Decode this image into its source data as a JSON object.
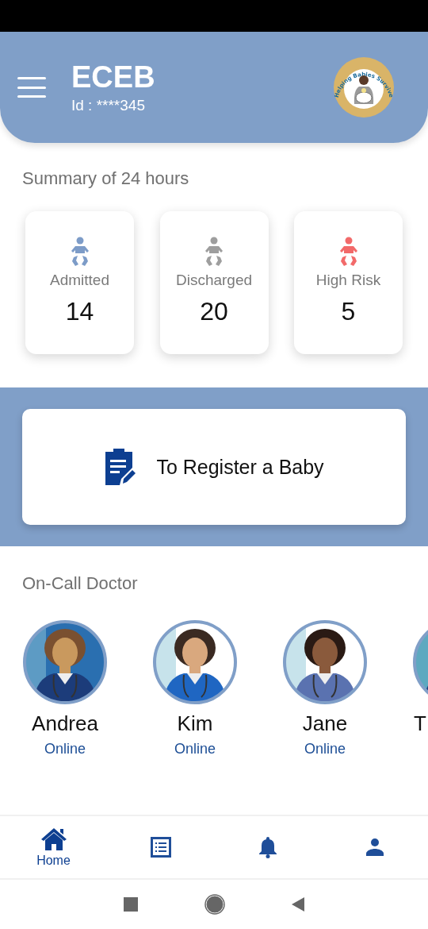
{
  "header": {
    "title": "ECEB",
    "id_text": "Id : ****345",
    "logo_text": "Helping Babies Survive"
  },
  "summary": {
    "title": "Summary of 24 hours",
    "stats": [
      {
        "label": "Admitted",
        "value": "14",
        "color": "#7d9cc8"
      },
      {
        "label": "Discharged",
        "value": "20",
        "color": "#9e9e9e"
      },
      {
        "label": "High Risk",
        "value": "5",
        "color": "#f26a6a"
      }
    ]
  },
  "register": {
    "label": "To Register a Baby"
  },
  "doctors": {
    "title": "On-Call Doctor",
    "items": [
      {
        "name": "Andrea",
        "status": "Online",
        "kind": "picture"
      },
      {
        "name": "Kim",
        "status": "Online",
        "kind": "picture"
      },
      {
        "name": "Jane",
        "status": "Online",
        "kind": "picture"
      },
      {
        "name": "T",
        "kind": "picture"
      }
    ]
  },
  "nav": [
    {
      "kind": "home",
      "label": "Home",
      "selected": true
    },
    {
      "kind": "list",
      "selected": false
    },
    {
      "kind": "bell",
      "selected": false
    },
    {
      "kind": "person",
      "selected": false
    }
  ]
}
